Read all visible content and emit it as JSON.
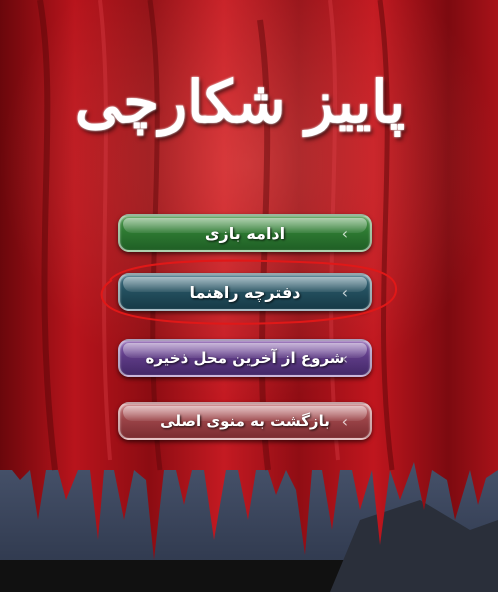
{
  "game": {
    "title": "پاییز شکارچی"
  },
  "menu": {
    "items": [
      {
        "label": "ادامه بازی",
        "icon": "chevron-right-icon",
        "color": "#2e7a32"
      },
      {
        "label": "دفترچه راهنما",
        "icon": "chevron-right-icon",
        "color": "#24505f",
        "highlighted": true
      },
      {
        "label": "شروع از آخرین محل ذخیره",
        "icon": "chevron-right-icon",
        "color": "#5e3b86"
      },
      {
        "label": "بازگشت به منوی اصلی",
        "icon": "chevron-right-icon",
        "color": "#9b4448"
      }
    ],
    "highlight_color": "#e01818"
  },
  "colors": {
    "banner_red": "#b5141c",
    "banner_dark": "#5a0608",
    "sky": "#6f7f9a"
  }
}
